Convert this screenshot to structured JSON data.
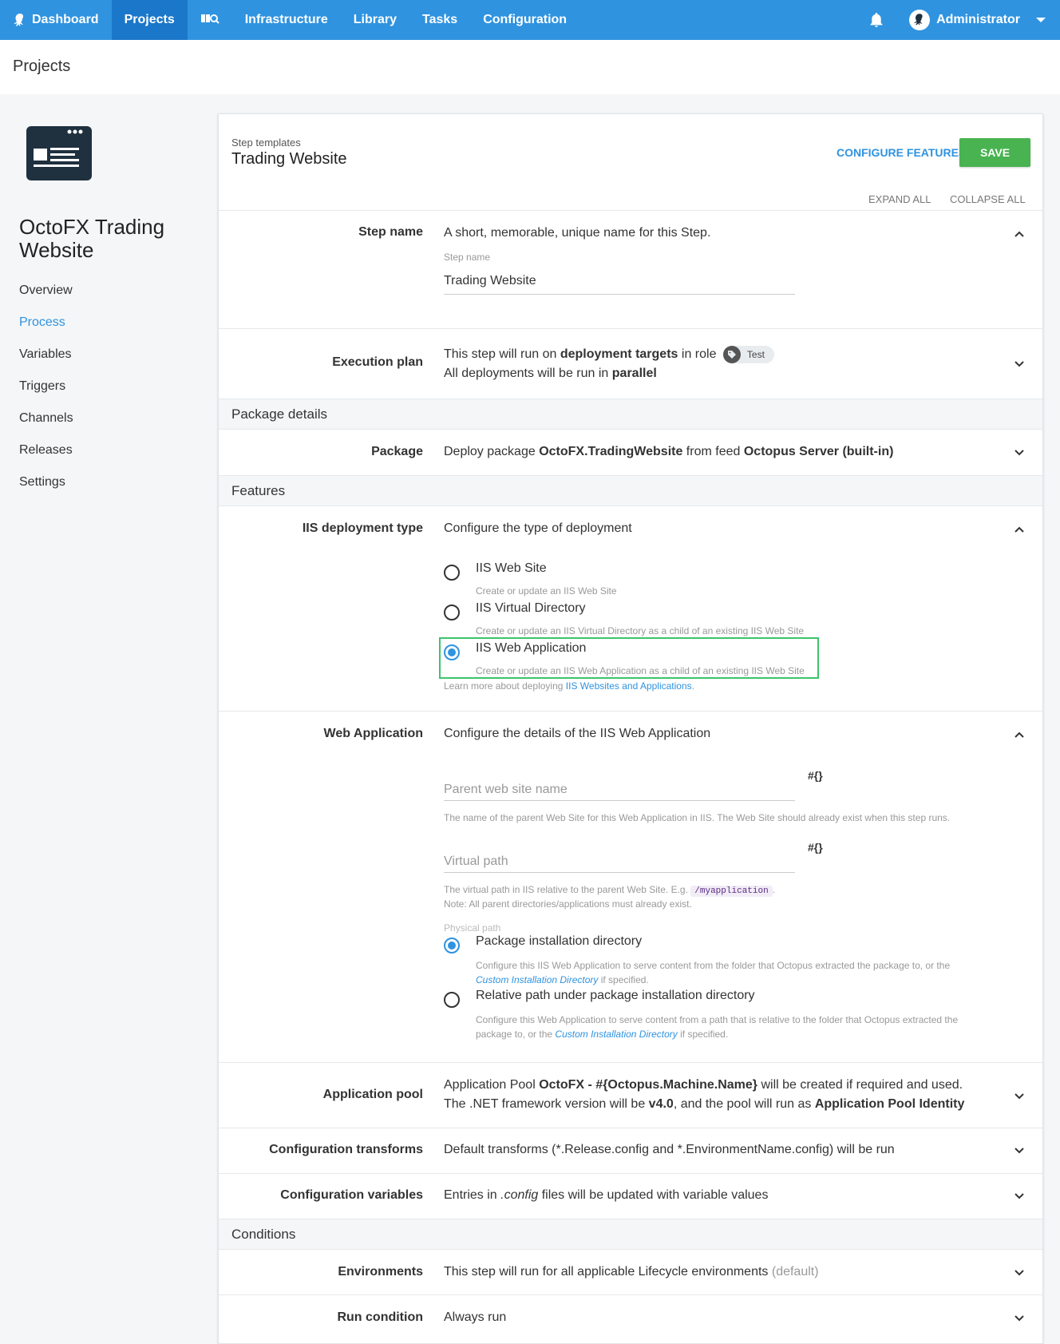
{
  "nav": {
    "dashboard": "Dashboard",
    "projects": "Projects",
    "infrastructure": "Infrastructure",
    "library": "Library",
    "tasks": "Tasks",
    "configuration": "Configuration",
    "user": "Administrator",
    "brand_color": "#2f93e0"
  },
  "page": {
    "title": "Projects"
  },
  "project": {
    "name": "OctoFX Trading Website",
    "menu": [
      "Overview",
      "Process",
      "Variables",
      "Triggers",
      "Channels",
      "Releases",
      "Settings"
    ],
    "active": "Process"
  },
  "header": {
    "breadcrumb": "Step templates",
    "title": "Trading Website",
    "configure_features": "CONFIGURE FEATURES",
    "save": "SAVE",
    "expand_all": "EXPAND ALL",
    "collapse_all": "COLLAPSE ALL"
  },
  "step_name": {
    "label": "Step name",
    "description": "A short, memorable, unique name for this Step.",
    "field_label": "Step name",
    "value": "Trading Website"
  },
  "execution_plan": {
    "label": "Execution plan",
    "line1_a": "This step will run on ",
    "line1_b": "deployment targets",
    "line1_c": " in role",
    "role": "Test",
    "line2_a": "All deployments will be run in ",
    "line2_b": "parallel"
  },
  "sections": {
    "package_details": "Package details",
    "features": "Features",
    "conditions": "Conditions"
  },
  "package": {
    "label": "Package",
    "text_a": "Deploy package ",
    "text_b": "OctoFX.TradingWebsite",
    "text_c": " from feed ",
    "text_d": "Octopus Server (built-in)"
  },
  "iis_type": {
    "label": "IIS deployment type",
    "description": "Configure the type of deployment",
    "options": [
      {
        "label": "IIS Web Site",
        "hint": "Create or update an IIS Web Site",
        "selected": false
      },
      {
        "label": "IIS Virtual Directory",
        "hint": "Create or update an IIS Virtual Directory as a child of an existing IIS Web Site",
        "selected": false
      },
      {
        "label": "IIS Web Application",
        "hint": "Create or update an IIS Web Application as a child of an existing IIS Web Site",
        "selected": true
      }
    ],
    "learn_more": "Learn more about deploying ",
    "learn_link": "IIS Websites and Applications",
    "learn_end": "."
  },
  "web_app": {
    "label": "Web Application",
    "description": "Configure the details of the IIS Web Application",
    "parent_placeholder": "Parent web site name",
    "parent_hint": "The name of the parent Web Site for this Web Application in IIS. The Web Site should already exist when this step runs.",
    "vpath_placeholder": "Virtual path",
    "vpath_hint_a": "The virtual path in IIS relative to the parent Web Site. E.g. ",
    "vpath_code": "/myapplication",
    "vpath_hint_b": ".",
    "vpath_note": "Note: All parent directories/applications must already exist.",
    "variable_icon": "#{}",
    "physical_label": "Physical path",
    "opt1_label": "Package installation directory",
    "opt1_hint_a": "Configure this IIS Web Application to serve content from the folder that Octopus extracted the package to, or the",
    "opt1_link": "Custom Installation Directory",
    "opt1_hint_b": " if specified.",
    "opt2_label": "Relative path under package installation directory",
    "opt2_hint_a": "Configure this Web Application to serve content from a path that is relative to the folder that Octopus extracted the",
    "opt2_hint_b": "package to, or the ",
    "opt2_link": "Custom Installation Directory",
    "opt2_hint_c": " if specified."
  },
  "app_pool": {
    "label": "Application pool",
    "a": "Application Pool ",
    "b": "OctoFX - #{Octopus.Machine.Name}",
    "c": " will be created if required and used. The .NET framework version will be ",
    "d": "v4.0",
    "e": ", and the pool will run as ",
    "f": "Application Pool Identity"
  },
  "config_transforms": {
    "label": "Configuration transforms",
    "text": "Default transforms (*.Release.config and *.EnvironmentName.config) will be run"
  },
  "config_variables": {
    "label": "Configuration variables",
    "a": "Entries in ",
    "b": ".config",
    "c": " files will be updated with variable values"
  },
  "environments": {
    "label": "Environments",
    "text": "This step will run for all applicable Lifecycle environments ",
    "default": "(default)"
  },
  "run_condition": {
    "label": "Run condition",
    "text": "Always run"
  }
}
